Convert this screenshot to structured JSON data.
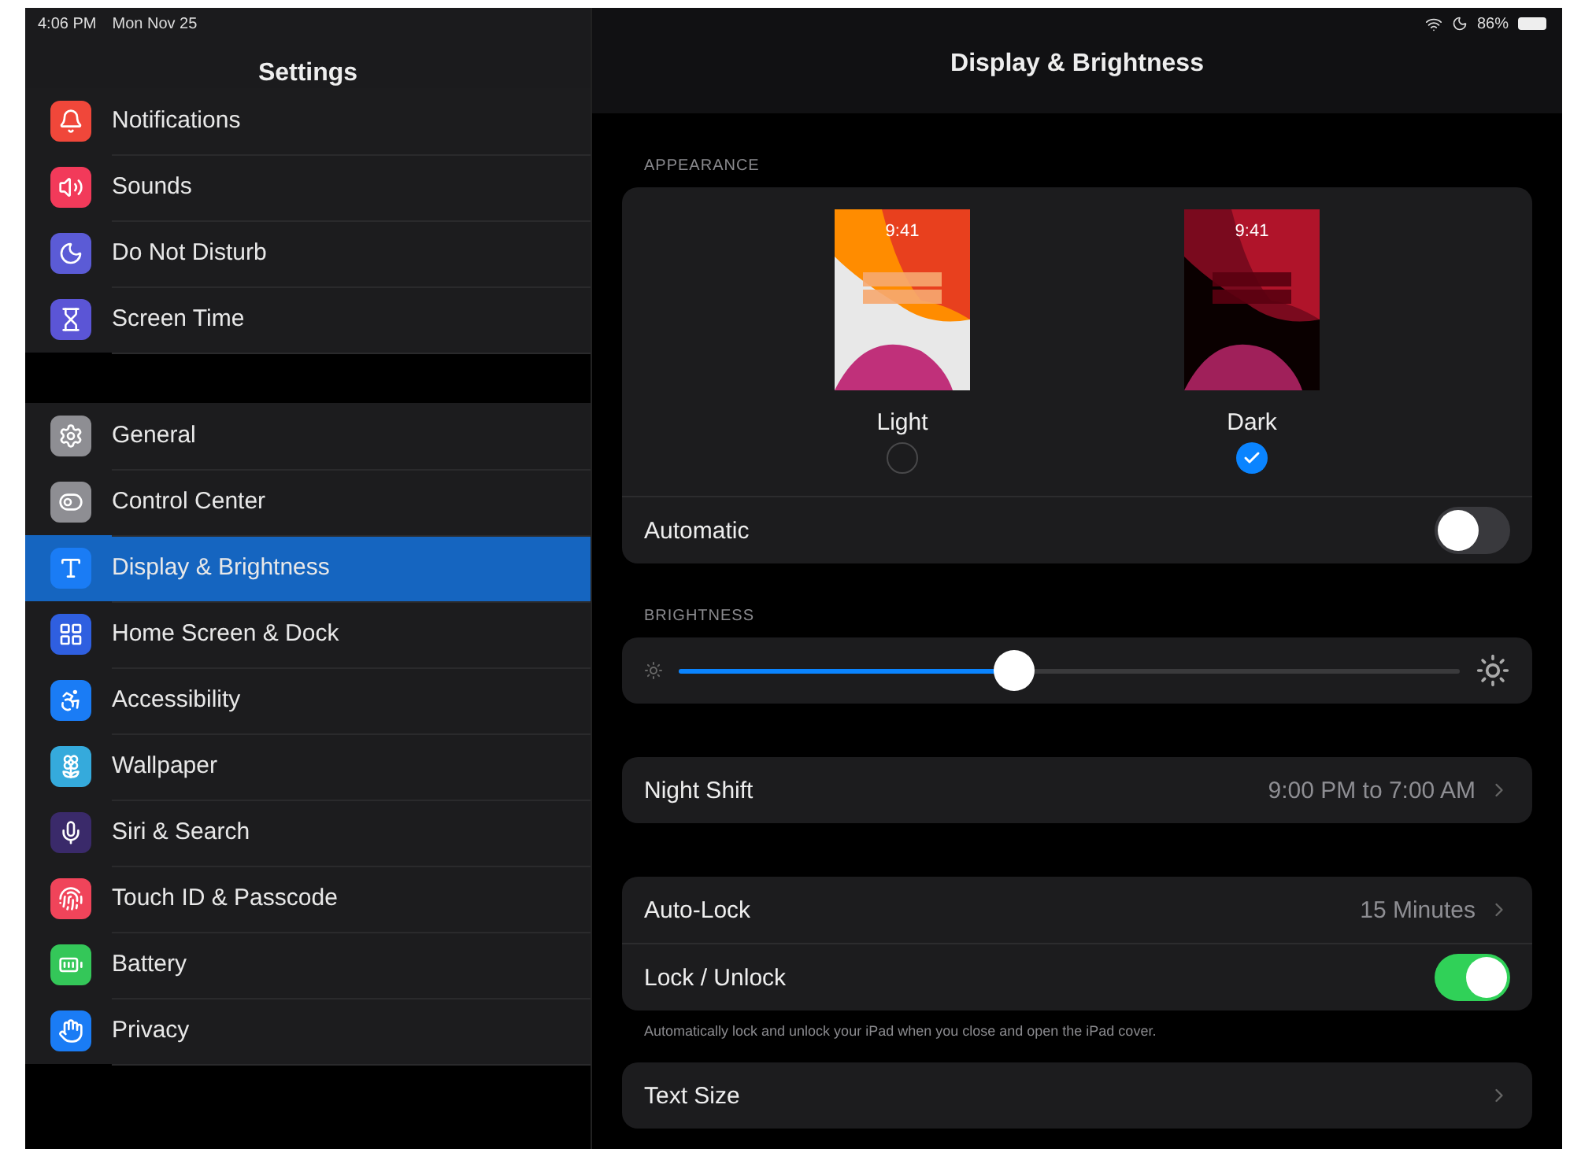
{
  "status_bar": {
    "time": "4:06 PM",
    "date": "Mon Nov 25",
    "battery": "86%"
  },
  "sidebar": {
    "title": "Settings",
    "groups": [
      [
        {
          "label": "Notifications",
          "color": "#f0473a",
          "selected": false
        },
        {
          "label": "Sounds",
          "color": "#f23a5a",
          "selected": false
        },
        {
          "label": "Do Not Disturb",
          "color": "#5b5bd6",
          "selected": false
        },
        {
          "label": "Screen Time",
          "color": "#5b55d6",
          "selected": false
        }
      ],
      [
        {
          "label": "General",
          "color": "#8e8e93",
          "selected": false
        },
        {
          "label": "Control Center",
          "color": "#8e8e93",
          "selected": false
        },
        {
          "label": "Display & Brightness",
          "color": "#1a7cf5",
          "selected": true
        },
        {
          "label": "Home Screen & Dock",
          "color": "#2f5fe0",
          "selected": false
        },
        {
          "label": "Accessibility",
          "color": "#1a7cf5",
          "selected": false
        },
        {
          "label": "Wallpaper",
          "color": "#35aadc",
          "selected": false
        },
        {
          "label": "Siri & Search",
          "color": "#3a2a6a",
          "selected": false
        },
        {
          "label": "Touch ID & Passcode",
          "color": "#f0445a",
          "selected": false
        },
        {
          "label": "Battery",
          "color": "#34c759",
          "selected": false
        },
        {
          "label": "Privacy",
          "color": "#1a7cf5",
          "selected": false
        }
      ]
    ]
  },
  "detail": {
    "title": "Display & Brightness",
    "appearance": {
      "header": "APPEARANCE",
      "options": [
        {
          "label": "Light",
          "time": "9:41",
          "kind": "light",
          "selected": false
        },
        {
          "label": "Dark",
          "time": "9:41",
          "kind": "dark",
          "selected": true
        }
      ],
      "automatic": {
        "label": "Automatic",
        "on": false
      }
    },
    "brightness": {
      "header": "BRIGHTNESS",
      "level": 0.43
    },
    "night_shift": {
      "label": "Night Shift",
      "value": "9:00 PM to 7:00 AM"
    },
    "lock": {
      "rows": [
        {
          "kind": "link",
          "label": "Auto-Lock",
          "value": "15 Minutes"
        },
        {
          "kind": "toggle",
          "label": "Lock / Unlock",
          "on": true
        }
      ],
      "note": "Automatically lock and unlock your iPad when you close and open the iPad cover."
    },
    "text_size": {
      "label": "Text Size"
    }
  }
}
